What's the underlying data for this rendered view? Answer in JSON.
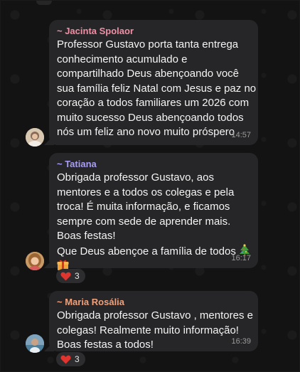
{
  "messages": [
    {
      "sender": "~ Jacinta Spolaor",
      "sender_color": "#f08fa3",
      "lines": [
        "Professor Gustavo porta tanta entrega",
        "conhecimento acumulado e",
        "compartilhado Deus abençoando você",
        "sua família feliz Natal com Jesus e paz no",
        "coração a todos familiares um 2026 com",
        "muito sucesso Deus abençoando todos",
        "nós um  feliz ano novo muito próspero"
      ],
      "time": "14:57"
    },
    {
      "sender": "~ Tatiana",
      "sender_color": "#a79cf5",
      "lines": [
        "Obrigada professor Gustavo, aos",
        "mentores e a todos os colegas  e pela",
        "troca! É muita informação, e ficamos",
        "sempre com sede de aprender mais.",
        "Boas festas!",
        "Que Deus abençoe a família de todos"
      ],
      "emojis": [
        "christmas-tree-icon",
        "gift-icon"
      ],
      "time": "16:17",
      "reaction": {
        "emoji": "heart-icon",
        "count": "3"
      }
    },
    {
      "sender": "~ Maria Rosália",
      "sender_color": "#f0a07a",
      "lines": [
        "Obrigada professor Gustavo , mentores e",
        "colegas! Realmente muito informação!",
        "Boas festas a todos!"
      ],
      "time": "16:39",
      "reaction": {
        "emoji": "heart-icon",
        "count": "3"
      }
    }
  ]
}
